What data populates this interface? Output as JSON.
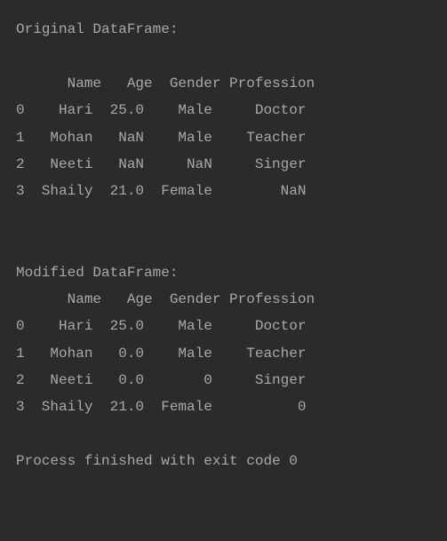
{
  "original": {
    "title": "Original DataFrame:",
    "header": "      Name   Age  Gender Profession",
    "rows": [
      "0    Hari  25.0    Male     Doctor",
      "1   Mohan   NaN    Male    Teacher",
      "2   Neeti   NaN     NaN     Singer",
      "3  Shaily  21.0  Female        NaN"
    ]
  },
  "modified": {
    "title": "Modified DataFrame:",
    "header": "      Name   Age  Gender Profession",
    "rows": [
      "0    Hari  25.0    Male     Doctor",
      "1   Mohan   0.0    Male    Teacher",
      "2   Neeti   0.0       0     Singer",
      "3  Shaily  21.0  Female          0"
    ]
  },
  "footer": "Process finished with exit code 0"
}
